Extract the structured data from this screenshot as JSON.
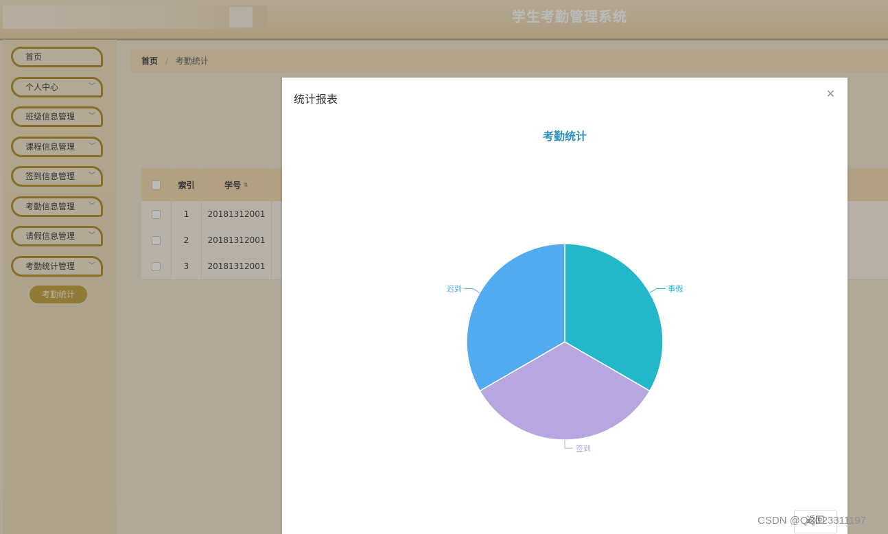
{
  "header": {
    "title": "学生考勤管理系统"
  },
  "sidebar": {
    "items": [
      {
        "label": "首页",
        "has_children": false
      },
      {
        "label": "个人中心",
        "has_children": true
      },
      {
        "label": "班级信息管理",
        "has_children": true
      },
      {
        "label": "课程信息管理",
        "has_children": true
      },
      {
        "label": "签到信息管理",
        "has_children": true
      },
      {
        "label": "考勤信息管理",
        "has_children": true
      },
      {
        "label": "请假信息管理",
        "has_children": true
      },
      {
        "label": "考勤统计管理",
        "has_children": true
      }
    ],
    "active_sub": "考勤统计"
  },
  "breadcrumb": {
    "home": "首页",
    "separator": "/",
    "current": "考勤统计"
  },
  "table": {
    "headers": {
      "index": "索引",
      "student_no": "学号"
    },
    "rows": [
      {
        "index": "1",
        "student_no": "20181312001"
      },
      {
        "index": "2",
        "student_no": "20181312001"
      },
      {
        "index": "3",
        "student_no": "20181312001"
      }
    ]
  },
  "modal": {
    "title": "统计报表",
    "footer_button": "返回"
  },
  "chart_data": {
    "type": "pie",
    "title": "考勤统计",
    "slices": [
      {
        "name": "事假",
        "value": 1,
        "color": "#22b8c9"
      },
      {
        "name": "签到",
        "value": 1,
        "color": "#b7a6df"
      },
      {
        "name": "迟到",
        "value": 1,
        "color": "#52abf0"
      }
    ]
  },
  "watermark": "CSDN @QQ123311197",
  "icons": {
    "close": "close-icon",
    "chevron": "chevron-down-icon",
    "sort": "sort-icon"
  }
}
